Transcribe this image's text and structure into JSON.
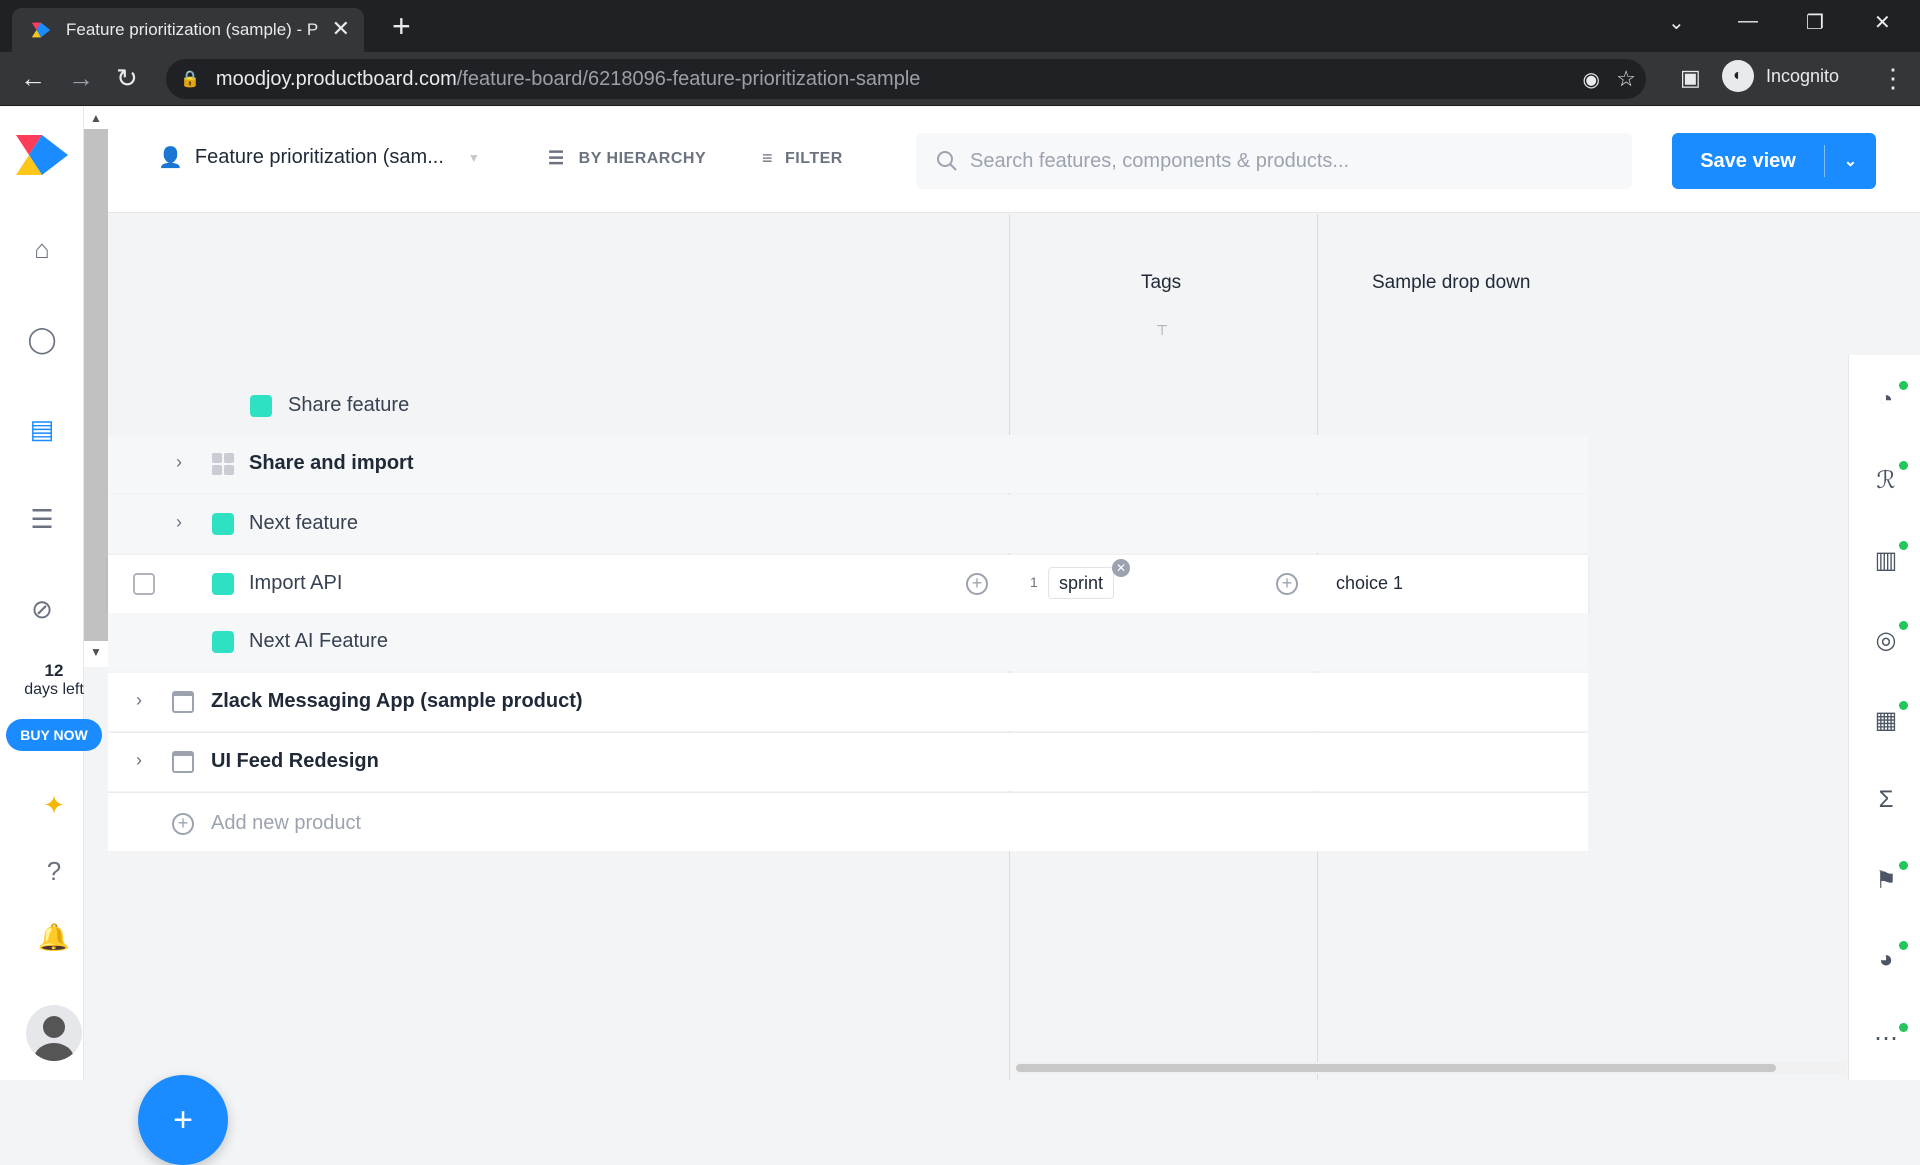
{
  "browser": {
    "tab_title": "Feature prioritization (sample) - P",
    "url_host": "moodjoy.productboard.com",
    "url_path": "/feature-board/6218096-feature-prioritization-sample",
    "profile_label": "Incognito"
  },
  "sidebar": {
    "days_number": "12",
    "days_label": "days left",
    "buy_now": "BUY NOW"
  },
  "toolbar": {
    "view_title": "Feature prioritization (sam...",
    "hierarchy_label": "BY HIERARCHY",
    "filter_label": "FILTER",
    "search_placeholder": "Search features, components & products...",
    "save_label": "Save view"
  },
  "columns": {
    "tags": "Tags",
    "dropdown": "Sample drop down"
  },
  "rows": {
    "share_feature": "Share feature",
    "share_import": "Share and import",
    "next_feature": "Next feature",
    "import_api": "Import API",
    "import_api_tag_count": "1",
    "import_api_tag": "sprint",
    "import_api_choice": "choice 1",
    "next_ai": "Next AI Feature",
    "zlack": "Zlack Messaging App (sample product)",
    "ui_feed": "UI Feed Redesign",
    "add_product": "Add new product"
  },
  "colors": {
    "brand_blue": "#1a8cff",
    "feature_teal": "#2de1c2",
    "status_green": "#22c55e"
  }
}
